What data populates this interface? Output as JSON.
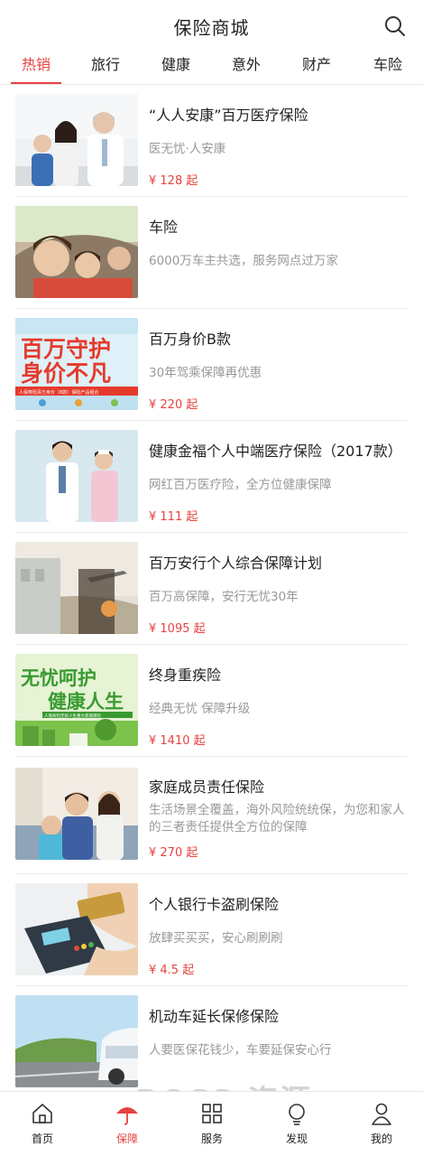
{
  "header": {
    "title": "保险商城",
    "search_icon": "search-icon"
  },
  "tabs": [
    {
      "label": "热销",
      "active": true
    },
    {
      "label": "旅行"
    },
    {
      "label": "健康"
    },
    {
      "label": "意外"
    },
    {
      "label": "财产"
    },
    {
      "label": "车险"
    }
  ],
  "products": [
    {
      "title": "“人人安康”百万医疗保险",
      "subtitle": "医无忧·人安康",
      "price": "¥ 128 起"
    },
    {
      "title": "车险",
      "subtitle": "6000万车主共选，服务网点过万家",
      "price": ""
    },
    {
      "title": "百万身价B款",
      "subtitle": "30年驾乘保障再优惠",
      "price": "¥ 220 起",
      "image_text": [
        "百万守护",
        "身价不凡",
        "人保寿险百万身价（B款）保险产品组合"
      ]
    },
    {
      "title": "健康金福个人中端医疗保险（2017款）",
      "subtitle": "网红百万医疗险，全方位健康保障",
      "price": "¥ 111 起"
    },
    {
      "title": "百万安行个人综合保障计划",
      "subtitle": "百万高保障，安行无忧30年",
      "price": "¥ 1095 起"
    },
    {
      "title": "终身重疾险",
      "subtitle": "经典无忧 保障升级",
      "price": "¥ 1410 起",
      "image_text": [
        "无忧呵护",
        "健康人生",
        "人保寿险无忧人生重大疾病保险"
      ]
    },
    {
      "title": "家庭成员责任保险",
      "subtitle": "生活场景全覆盖，海外风险统统保，为您和家人的三者责任提供全方位的保障",
      "price": "¥ 270 起"
    },
    {
      "title": "个人银行卡盗刷保险",
      "subtitle": "放肆买买买，安心刷刷刷",
      "price": "¥ 4.5 起"
    },
    {
      "title": "机动车延长保修保险",
      "subtitle": "人要医保花钱少，车要延保安心行",
      "price": ""
    }
  ],
  "bottom_nav": [
    {
      "label": "首页",
      "icon": "home-icon"
    },
    {
      "label": "保障",
      "icon": "umbrella-icon",
      "active": true
    },
    {
      "label": "服务",
      "icon": "grid-icon"
    },
    {
      "label": "发现",
      "icon": "bulb-icon"
    },
    {
      "label": "我的",
      "icon": "user-icon"
    }
  ],
  "watermark": "BOSS 资源",
  "colors": {
    "accent": "#e64340",
    "text": "#222222",
    "muted": "#999999"
  }
}
